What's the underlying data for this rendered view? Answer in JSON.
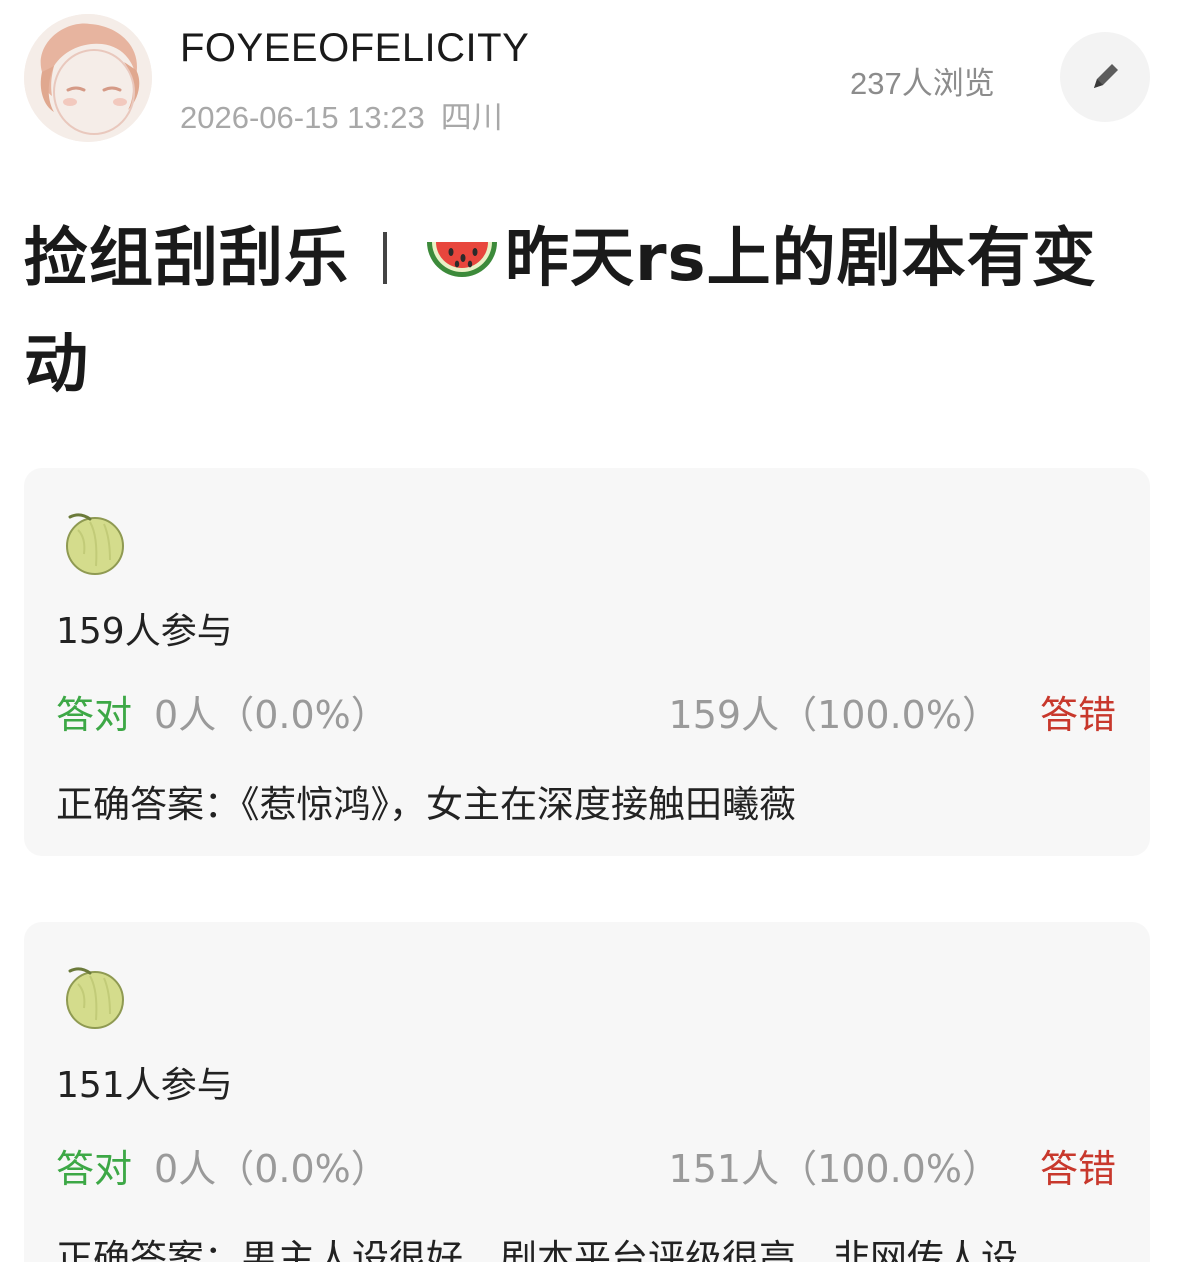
{
  "header": {
    "username": "FOYEEOFELICITY",
    "datetime": "2026-06-15 13:23",
    "location": "四川",
    "views": "237人浏览",
    "edit_icon": "pencil-icon"
  },
  "post": {
    "title_part1": "捡组刮刮乐",
    "title_part2": "昨天rs上的剧本有变动",
    "title_icon": "watermelon-icon"
  },
  "quizzes": [
    {
      "icon": "melon-icon",
      "participants": "159人参与",
      "correct_label": "答对",
      "correct_count": "0人（0.0%）",
      "wrong_count": "159人（100.0%）",
      "wrong_label": "答错",
      "answer": "正确答案：《惹惊鸿》，女主在深度接触田曦薇"
    },
    {
      "icon": "melon-icon",
      "participants": "151人参与",
      "correct_label": "答对",
      "correct_count": "0人（0.0%）",
      "wrong_count": "151人（100.0%）",
      "wrong_label": "答错",
      "answer": "正确答案：男主人设很好，剧本平台评级很高，非网传人设"
    }
  ],
  "colors": {
    "correct": "#3da846",
    "wrong": "#c8382c",
    "muted": "#9a9a9a",
    "card_bg": "#f7f7f7"
  }
}
